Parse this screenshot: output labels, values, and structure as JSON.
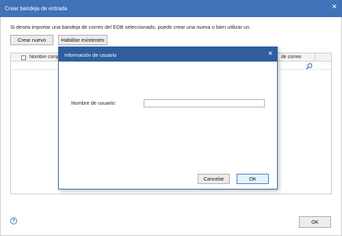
{
  "window": {
    "title": "Crear bandeja de entrada",
    "intro_text": "Si desea importar una bandeja de correo del EDB seleccionado, puede crear una nueva o bien utilizar un.",
    "buttons": {
      "create_new": "Crear nuevo",
      "enable_existing": "Habilitar existentes",
      "ok": "OK"
    },
    "grid": {
      "columns": [
        "Nombre comp",
        "de correo"
      ]
    },
    "help_label": "?"
  },
  "dialog": {
    "title": "Información de usuario",
    "username_label": "Nombre de usuario:",
    "username_value": "",
    "buttons": {
      "cancel": "Cancelar",
      "ok": "OK"
    }
  },
  "icons": {
    "close": "close-icon",
    "search": "search-icon",
    "help": "help-icon"
  },
  "colors": {
    "title_bar": "#3f72b7",
    "dialog_title_bar": "#2f5e9e",
    "ok_highlight": "#e5f1fb",
    "ok_border": "#2f77c9"
  }
}
